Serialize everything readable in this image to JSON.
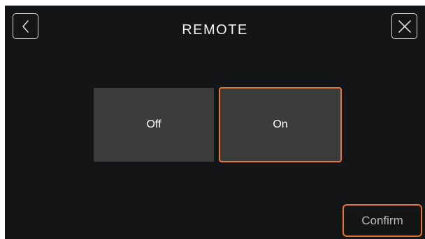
{
  "header": {
    "title": "REMOTE",
    "back_icon": "chevron-left-icon",
    "close_icon": "close-icon"
  },
  "options": {
    "off_label": "Off",
    "on_label": "On",
    "selected": "On"
  },
  "footer": {
    "confirm_label": "Confirm"
  },
  "colors": {
    "background": "#131516",
    "option_bg": "#3a3d3c",
    "accent": "#e8782e",
    "text": "#f2f2f2",
    "muted_text": "#b9b9b9"
  }
}
